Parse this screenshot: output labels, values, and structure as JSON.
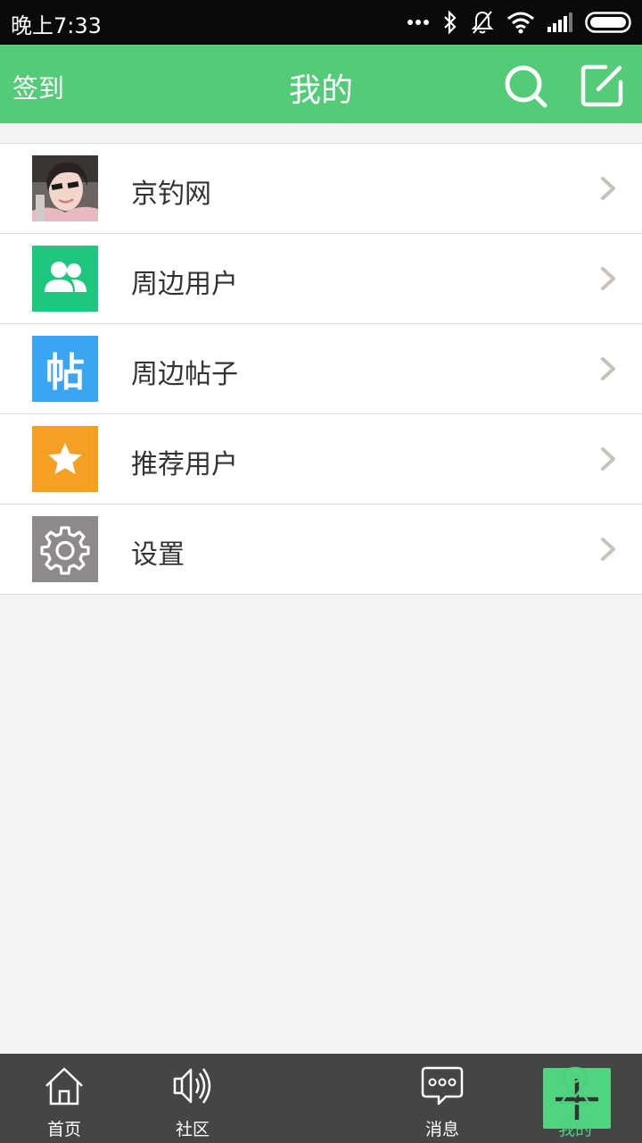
{
  "status_bar": {
    "time": "晚上7:33"
  },
  "header": {
    "left_action": "签到",
    "title": "我的"
  },
  "menu": {
    "items": [
      {
        "label": "京钓网",
        "icon": "avatar-photo"
      },
      {
        "label": "周边用户",
        "icon": "users-icon",
        "color": "#1fc67d"
      },
      {
        "label": "周边帖子",
        "icon": "post-char-icon",
        "icon_text": "帖",
        "color": "#3aa6f3"
      },
      {
        "label": "推荐用户",
        "icon": "star-icon",
        "color": "#f5a023"
      },
      {
        "label": "设置",
        "icon": "gear-icon",
        "color": "#8e8a8a"
      }
    ]
  },
  "tabs": [
    {
      "label": "首页",
      "icon": "home-icon"
    },
    {
      "label": "社区",
      "icon": "speaker-icon"
    },
    {
      "label": "",
      "icon": "plus-icon"
    },
    {
      "label": "消息",
      "icon": "chat-icon"
    },
    {
      "label": "我的",
      "icon": "location-pin-icon",
      "active": true
    }
  ],
  "colors": {
    "header": "#53cb77",
    "tab_bar": "#454545",
    "active_tab": "#4cd07d"
  }
}
